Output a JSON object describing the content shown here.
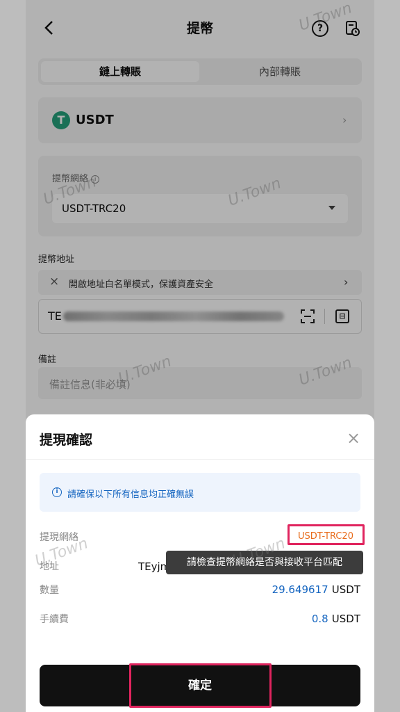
{
  "header": {
    "title": "提幣"
  },
  "tabs": {
    "onchain": "鏈上轉賬",
    "internal": "內部轉賬"
  },
  "coin": {
    "symbol": "USDT",
    "icon": "tether-icon"
  },
  "network": {
    "label": "提幣網絡",
    "value": "USDT-TRC20"
  },
  "address": {
    "label": "提幣地址",
    "whitelist_text": "開啟地址白名單模式，保護資產安全",
    "value_prefix": "TE"
  },
  "memo": {
    "label": "備註",
    "placeholder": "備註信息(非必填)"
  },
  "watermark": "U.Town",
  "dialog": {
    "title": "提現確認",
    "notice": "請確保以下所有信息均正確無誤",
    "network_label": "提現網絡",
    "network_value": "USDT-TRC20",
    "address_label": "地址",
    "address_value": "TEyjm",
    "tooltip": "請檢查提幣網絡是否與接收平台匹配",
    "amount_label": "數量",
    "amount_value": "29.649617",
    "amount_unit": "USDT",
    "fee_label": "手續費",
    "fee_value": "0.8",
    "fee_unit": "USDT",
    "confirm": "確定"
  },
  "colors": {
    "accent_blue": "#1565c0",
    "highlight_frame": "#e0245e",
    "network_orange": "#e86b1a",
    "tether_green": "#26a17b"
  }
}
